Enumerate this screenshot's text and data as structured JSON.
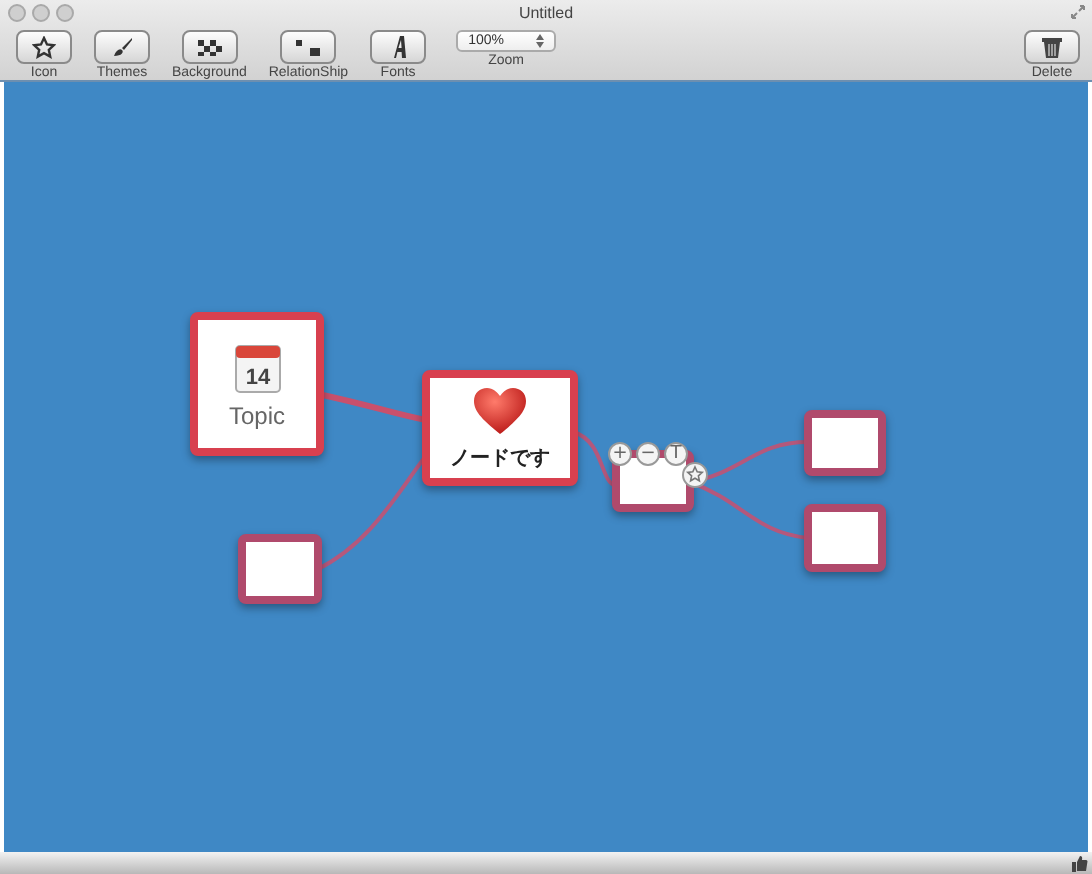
{
  "window": {
    "title": "Untitled"
  },
  "toolbar": [
    {
      "label": "Icon",
      "kind": "star"
    },
    {
      "label": "Themes",
      "kind": "brush"
    },
    {
      "label": "Background",
      "kind": "checker"
    },
    {
      "label": "RelationShip",
      "kind": "relation"
    },
    {
      "label": "Fonts",
      "kind": "font"
    }
  ],
  "zoom": {
    "value": "100%",
    "label": "Zoom"
  },
  "delete": {
    "label": "Delete"
  },
  "nodes": [
    {
      "kind": "calendar",
      "date": "14",
      "label": "Topic",
      "selected": true
    },
    {
      "kind": "heart",
      "label": "ノードです",
      "selected": true
    },
    {
      "kind": "blank",
      "selected": false
    },
    {
      "kind": "blank",
      "selected": false,
      "controls": [
        "+",
        "−",
        "T"
      ]
    },
    {
      "kind": "blank",
      "selected": false
    },
    {
      "kind": "blank",
      "selected": false
    }
  ]
}
